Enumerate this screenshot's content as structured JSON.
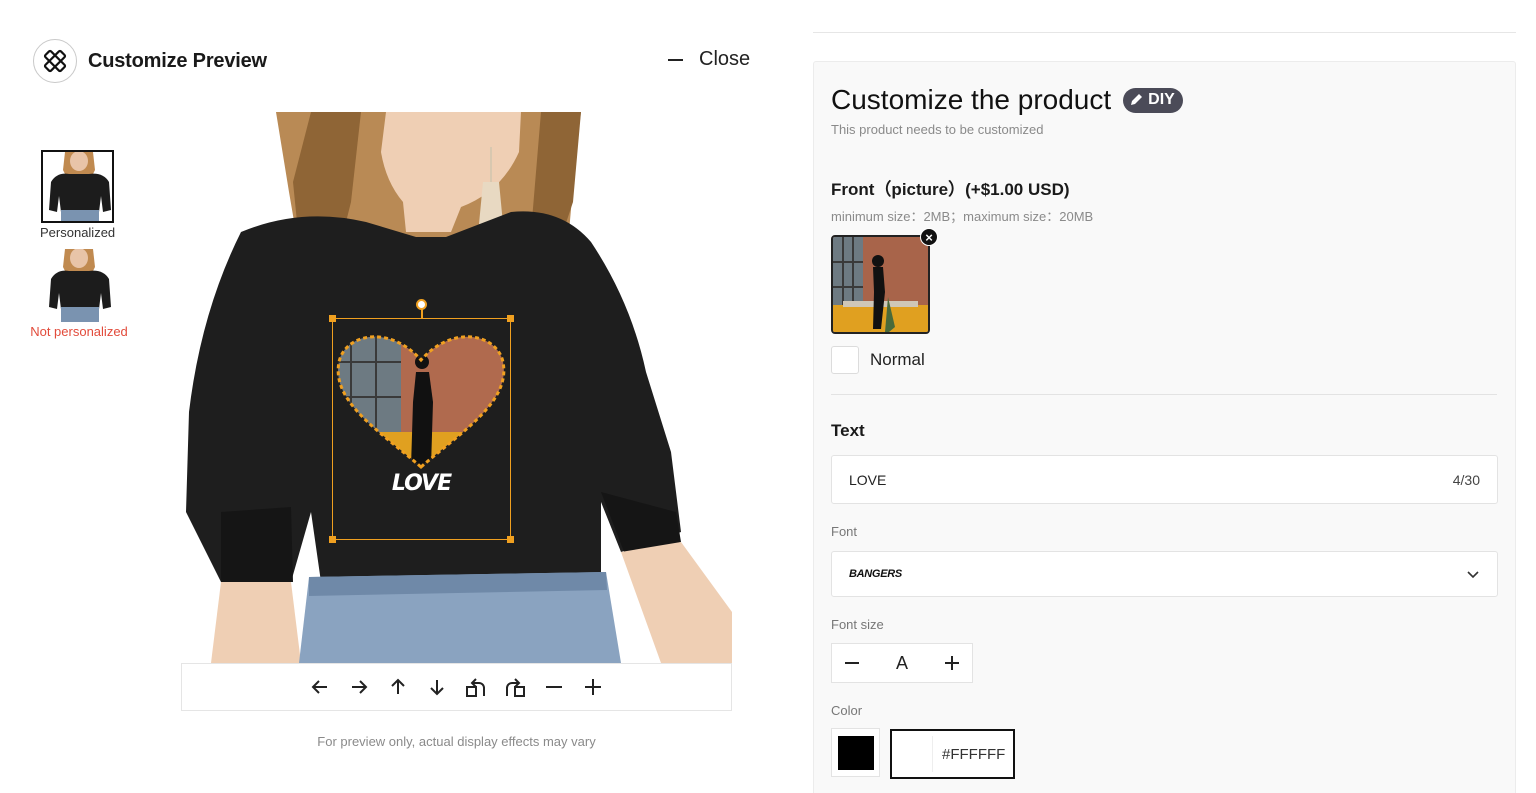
{
  "header": {
    "title": "Customize Preview",
    "close_label": "Close"
  },
  "thumbnails": [
    {
      "label": "Personalized",
      "selected": true
    },
    {
      "label": "Not personalized",
      "selected": false,
      "label_color": "#e24b3b"
    }
  ],
  "canvas": {
    "overlay_text": "LOVE",
    "selection_color": "#f0a020"
  },
  "toolbar": {
    "buttons": [
      "arrow-left-icon",
      "arrow-right-icon",
      "arrow-up-icon",
      "arrow-down-icon",
      "rotate-left-icon",
      "rotate-right-icon",
      "zoom-out-icon",
      "zoom-in-icon"
    ]
  },
  "disclaimer": "For preview only, actual display effects may vary",
  "panel": {
    "title": "Customize the product",
    "badge": "DIY",
    "subtitle": "This product needs to be customized",
    "front": {
      "title": "Front（picture）(+$1.00 USD)",
      "hint": "minimum size：2MB；maximum size：20MB",
      "option_label": "Normal"
    },
    "text": {
      "title": "Text",
      "value": "LOVE",
      "count": "4/30"
    },
    "font": {
      "label": "Font",
      "value": "BANGERS"
    },
    "font_size": {
      "label": "Font size",
      "value": "A"
    },
    "color": {
      "label": "Color",
      "swatch": "#000000",
      "hex": "#FFFFFF"
    }
  },
  "colors": {
    "accent": "#f0a020",
    "error": "#e24b3b",
    "badge_bg": "#4b4b58"
  }
}
